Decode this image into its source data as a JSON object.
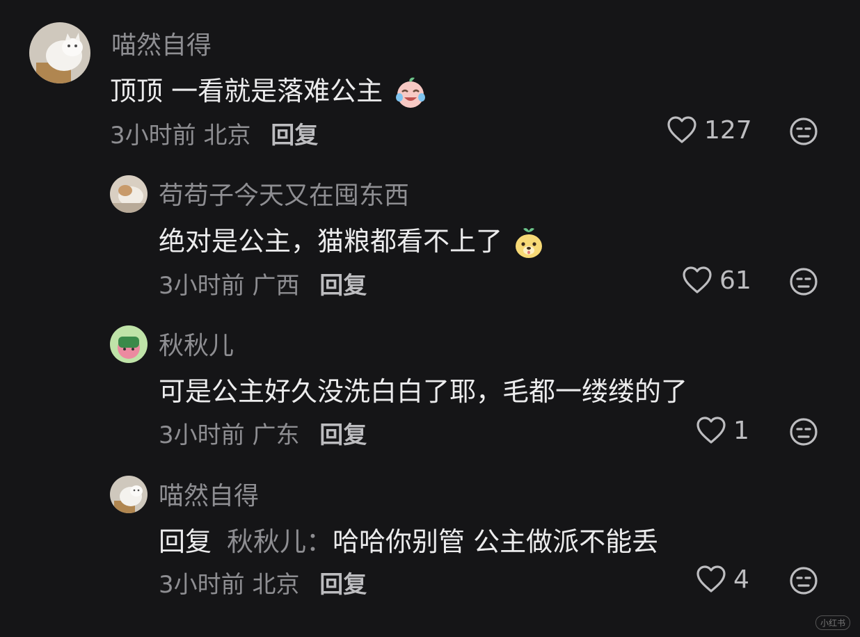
{
  "comments": [
    {
      "username": "喵然自得",
      "text": "顶顶 一看就是落难公主",
      "emoji_icon": "crying-laughing-face-emoji",
      "time": "3小时前",
      "location": "北京",
      "reply_label": "回复",
      "likes": "127"
    },
    {
      "username": "苟苟子今天又在囤东西",
      "text": "绝对是公主，猫粮都看不上了",
      "emoji_icon": "yellow-puppy-emoji",
      "time": "3小时前",
      "location": "广西",
      "reply_label": "回复",
      "likes": "61"
    },
    {
      "username": "秋秋儿",
      "text": "可是公主好久没洗白白了耶，毛都一缕缕的了",
      "time": "3小时前",
      "location": "广东",
      "reply_label": "回复",
      "likes": "1"
    },
    {
      "username": "喵然自得",
      "reply_prefix": "回复",
      "reply_target": "秋秋儿：",
      "text": "哈哈你别管 公主做派不能丢",
      "time": "3小时前",
      "location": "北京",
      "reply_label": "回复",
      "likes": "4"
    }
  ],
  "watermark": "小红书",
  "colors": {
    "background": "#151517",
    "username": "#8e8e92",
    "text": "#ececed"
  },
  "icons": [
    "heart-outline-icon",
    "neutral-face-icon"
  ]
}
